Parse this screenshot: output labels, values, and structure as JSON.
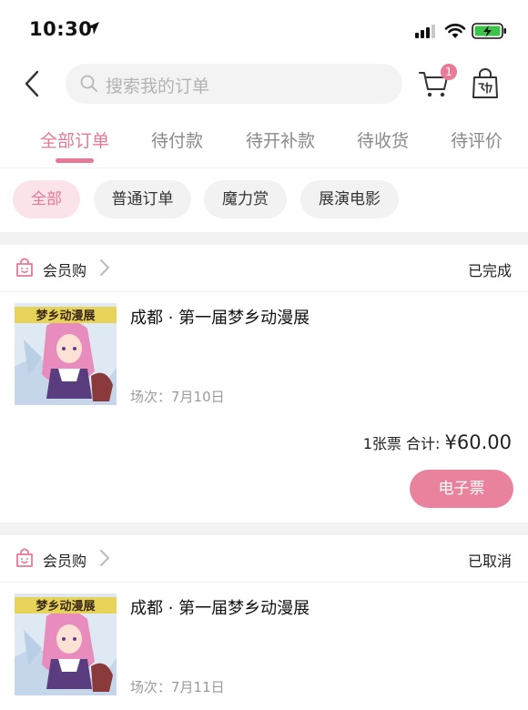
{
  "status_bar": {
    "time": "10:30"
  },
  "search": {
    "placeholder": "搜索我的订单"
  },
  "cart": {
    "badge": "1"
  },
  "tabs": [
    {
      "label": "全部订单",
      "active": true
    },
    {
      "label": "待付款"
    },
    {
      "label": "待开补款"
    },
    {
      "label": "待收货"
    },
    {
      "label": "待评价"
    }
  ],
  "filters": [
    {
      "label": "全部",
      "active": true
    },
    {
      "label": "普通订单"
    },
    {
      "label": "魔力赏"
    },
    {
      "label": "展演电影"
    }
  ],
  "orders": [
    {
      "shop": "会员购",
      "status": "已完成",
      "title": "成都 · 第一届梦乡动漫展",
      "session": "场次：7月10日",
      "count": "1张票 合计:",
      "price": "¥60.00",
      "action": "电子票",
      "poster_text": "梦乡动漫展"
    },
    {
      "shop": "会员购",
      "status": "已取消",
      "title": "成都 · 第一届梦乡动漫展",
      "session": "场次：7月11日",
      "poster_text": "梦乡动漫展"
    }
  ],
  "colors": {
    "accent": "#e77896",
    "accent_soft": "#fbe3ea",
    "button": "#e8829d"
  }
}
